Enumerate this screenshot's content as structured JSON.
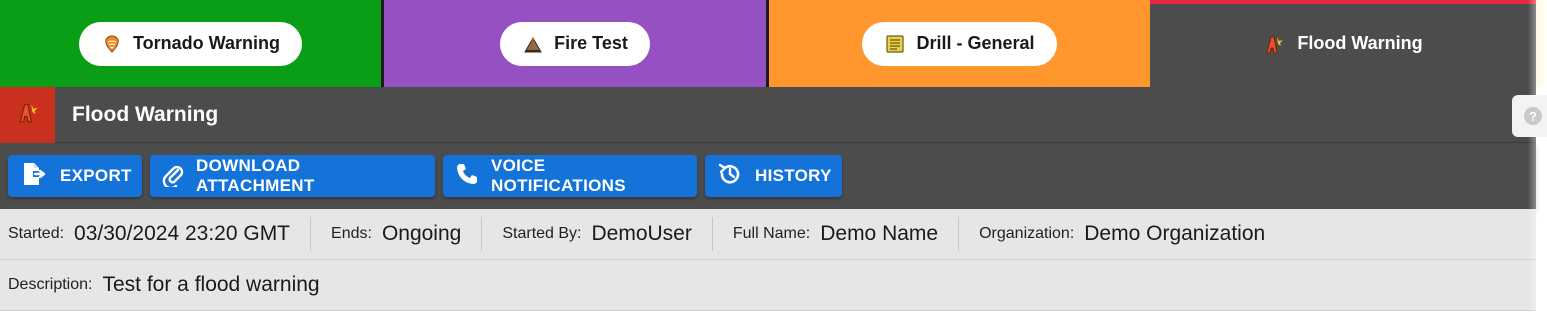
{
  "tabs": [
    {
      "label": "Tornado Warning",
      "icon": "tornado-icon",
      "color": "#0a9e17"
    },
    {
      "label": "Fire Test",
      "icon": "fire-icon",
      "color": "#9551c2"
    },
    {
      "label": "Drill - General",
      "icon": "notepad-icon",
      "color": "#ff962e"
    },
    {
      "label": "Flood Warning",
      "icon": "flood-icon",
      "color": "#4c4c4c",
      "active": true
    }
  ],
  "header": {
    "title": "Flood Warning",
    "icon": "flood-icon",
    "accent": "#c9311e"
  },
  "toolbar": {
    "export_label": "EXPORT",
    "download_label": "DOWNLOAD ATTACHMENT",
    "voice_label": "VOICE NOTIFICATIONS",
    "history_label": "HISTORY",
    "button_color": "#1473d8"
  },
  "details": {
    "started_label": "Started:",
    "started_value": "03/30/2024 23:20 GMT",
    "ends_label": "Ends:",
    "ends_value": "Ongoing",
    "started_by_label": "Started By:",
    "started_by_value": "DemoUser",
    "full_name_label": "Full Name:",
    "full_name_value": "Demo Name",
    "organization_label": "Organization:",
    "organization_value": "Demo Organization",
    "description_label": "Description:",
    "description_value": "Test for a flood warning"
  },
  "help": {
    "icon": "help-icon",
    "glyph": "?"
  }
}
